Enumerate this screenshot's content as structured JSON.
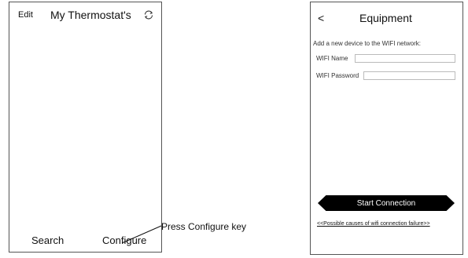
{
  "left_screen": {
    "edit_label": "Edit",
    "title": "My Thermostat's",
    "refresh_icon": "refresh-icon",
    "tabs": [
      {
        "label": "Search"
      },
      {
        "label": "Configure"
      }
    ]
  },
  "callout": {
    "text": "Press Configure key"
  },
  "right_screen": {
    "back_label": "<",
    "title": "Equipment",
    "instruction": "Add a new device to the WIFI network:",
    "wifi_name": {
      "label": "WIFI Name",
      "value": "",
      "placeholder": ""
    },
    "wifi_password": {
      "label": "WIFI Password",
      "value": "",
      "placeholder": ""
    },
    "start_button_label": "Start Connection",
    "failure_link": "<<Possible causes of wifi connection failure>>"
  }
}
